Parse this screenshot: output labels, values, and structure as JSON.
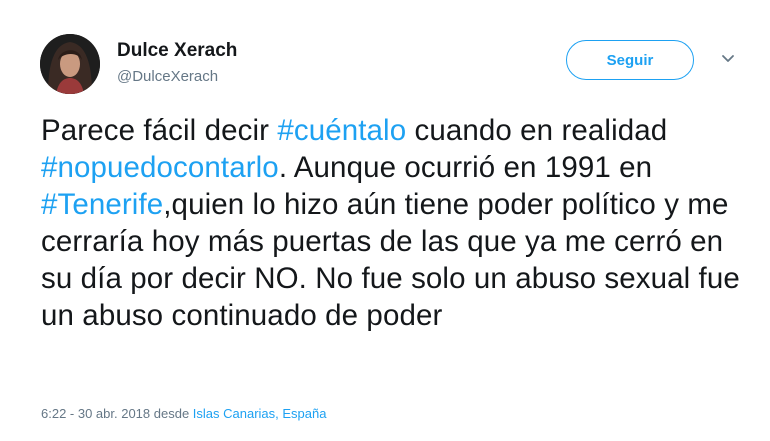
{
  "user": {
    "display_name": "Dulce Xerach",
    "handle": "@DulceXerach"
  },
  "follow_button": {
    "label": "Seguir"
  },
  "tweet": {
    "t1": "Parece fácil decir ",
    "hashtag1": "#cuéntalo",
    "t2": " cuando en realidad ",
    "hashtag2": "#nopuedocontarlo",
    "t3": ". Aunque ocurrió en 1991 en ",
    "hashtag3": "#Tenerife",
    "t4": ",quien lo hizo aún tiene poder político y me cerraría hoy más puertas de las que ya me cerró en su día por decir NO. No fue solo un abuso sexual fue un abuso continuado de poder"
  },
  "meta": {
    "time": "6:22 - 30 abr. 2018 desde ",
    "location": "Islas Canarias, España"
  },
  "colors": {
    "accent": "#1da1f2",
    "secondary_text": "#657786",
    "primary_text": "#14171a"
  },
  "icons": {
    "avatar": "profile-photo",
    "menu": "chevron-down-icon"
  }
}
